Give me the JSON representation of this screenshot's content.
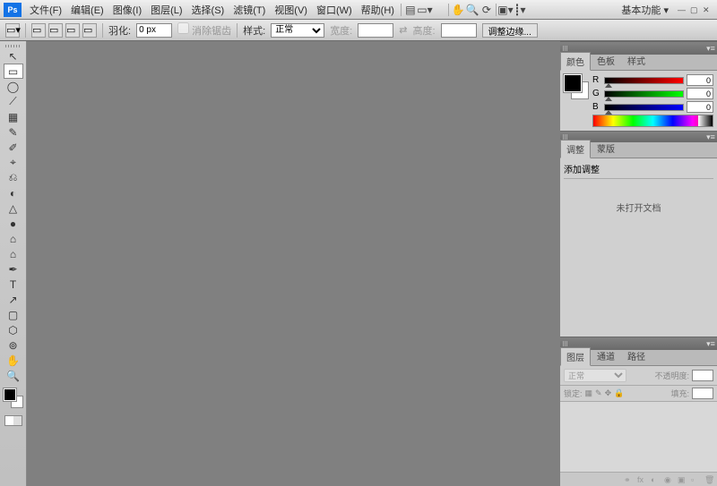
{
  "menubar": {
    "items": [
      "文件(F)",
      "编辑(E)",
      "图像(I)",
      "图层(L)",
      "选择(S)",
      "滤镜(T)",
      "视图(V)",
      "窗口(W)",
      "帮助(H)"
    ],
    "workspace": "基本功能"
  },
  "optionbar": {
    "feather_label": "羽化:",
    "feather_value": "0 px",
    "antialias_label": "消除锯齿",
    "style_label": "样式:",
    "style_value": "正常",
    "width_label": "宽度:",
    "height_label": "高度:",
    "refine_label": "调整边缘..."
  },
  "tools": [
    "↖",
    "▭",
    "◯",
    "⟋",
    "▦",
    "✎",
    "✐",
    "⌖",
    "⎌",
    "◐",
    "△",
    "●",
    "⌂",
    "T",
    "↗",
    "▢",
    "✋",
    "🔍"
  ],
  "color_panel": {
    "tabs": [
      "颜色",
      "色板",
      "样式"
    ],
    "r_label": "R",
    "r_value": "0",
    "g_label": "G",
    "g_value": "0",
    "b_label": "B",
    "b_value": "0"
  },
  "adjust_panel": {
    "tabs": [
      "调整",
      "蒙版"
    ],
    "title": "添加调整",
    "empty": "未打开文档"
  },
  "layers_panel": {
    "tabs": [
      "图层",
      "通道",
      "路径"
    ],
    "blend": "正常",
    "opacity_label": "不透明度:",
    "lock_label": "锁定:",
    "fill_label": "填充:"
  }
}
